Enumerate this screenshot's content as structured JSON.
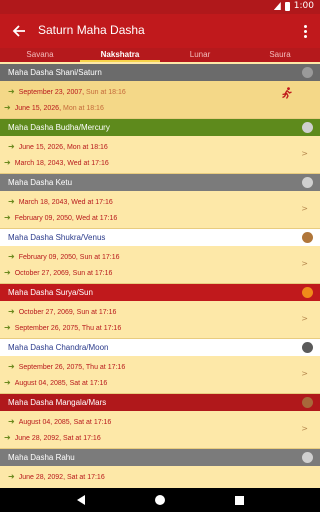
{
  "status_bar": {
    "time": "1:00"
  },
  "app_bar": {
    "title": "Saturn Maha Dasha",
    "back_icon": "arrow-left-icon",
    "menu_icon": "more-vert-icon"
  },
  "tabs": [
    {
      "label": "Savana",
      "active": false
    },
    {
      "label": "Nakshatra",
      "active": true
    },
    {
      "label": "Lunar",
      "active": false
    },
    {
      "label": "Saura",
      "active": false
    }
  ],
  "dashas": [
    {
      "title": "Maha Dasha Shani/Saturn",
      "header_bg": "#6b6b6b",
      "header_fg": "#ffffff",
      "icon_color": "#9a9a9a",
      "icon": "saturn-icon",
      "start": "September 23, 2007,",
      "start_day": "Sun at 18:16",
      "end": "June 15, 2026,",
      "end_day": "Mon at 18:16",
      "selected": true,
      "current": true,
      "chevron": ""
    },
    {
      "title": "Maha Dasha Budha/Mercury",
      "header_bg": "#5e8a1c",
      "header_fg": "#ffffff",
      "icon_color": "#cfcfcf",
      "icon": "mercury-icon",
      "start": "June 15, 2026, Mon at 18:16",
      "start_day": "",
      "end": "March 18, 2043, Wed at 17:16",
      "end_day": "",
      "selected": false,
      "current": false,
      "chevron": ">"
    },
    {
      "title": "Maha Dasha Ketu",
      "header_bg": "#7b7b7b",
      "header_fg": "#ffffff",
      "icon_color": "#d0d0d0",
      "icon": "ketu-icon",
      "start": "March 18, 2043, Wed at 17:16",
      "start_day": "",
      "end": "February 09, 2050, Wed at 17:16",
      "end_day": "",
      "selected": false,
      "current": false,
      "chevron": ">"
    },
    {
      "title": "Maha Dasha Shukra/Venus",
      "header_bg": "#ffffff",
      "header_fg": "#2a3a8a",
      "icon_color": "#b0763a",
      "icon": "venus-icon",
      "start": "February 09, 2050, Sun at 17:16",
      "start_day": "",
      "end": "October 27, 2069, Sun at 17:16",
      "end_day": "",
      "selected": false,
      "current": false,
      "chevron": ">"
    },
    {
      "title": "Maha Dasha Surya/Sun",
      "header_bg": "#c0191c",
      "header_fg": "#ffffff",
      "icon_color": "#f08a1a",
      "icon": "sun-icon",
      "start": "October 27, 2069, Sun at 17:16",
      "start_day": "",
      "end": "September 26, 2075, Thu at 17:16",
      "end_day": "",
      "selected": false,
      "current": false,
      "chevron": ">"
    },
    {
      "title": "Maha Dasha Chandra/Moon",
      "header_bg": "#ffffff",
      "header_fg": "#2a3a8a",
      "icon_color": "#5a5a5a",
      "icon": "moon-icon",
      "start": "September 26, 2075, Thu at 17:16",
      "start_day": "",
      "end": "August 04, 2085, Sat at 17:16",
      "end_day": "",
      "selected": false,
      "current": false,
      "chevron": ">"
    },
    {
      "title": "Maha Dasha Mangala/Mars",
      "header_bg": "#b0181b",
      "header_fg": "#ffffff",
      "icon_color": "#a8683a",
      "icon": "mars-icon",
      "start": "August 04, 2085, Sat at 17:16",
      "start_day": "",
      "end": "June 28, 2092, Sat at 17:16",
      "end_day": "",
      "selected": false,
      "current": false,
      "chevron": ">"
    },
    {
      "title": "Maha Dasha Rahu",
      "header_bg": "#7b7b7b",
      "header_fg": "#ffffff",
      "icon_color": "#d0d0d0",
      "icon": "rahu-icon",
      "start": "June 28, 2092, Sat at 17:16",
      "start_day": "",
      "end": "",
      "end_day": "",
      "selected": false,
      "current": false,
      "chevron": ""
    }
  ]
}
